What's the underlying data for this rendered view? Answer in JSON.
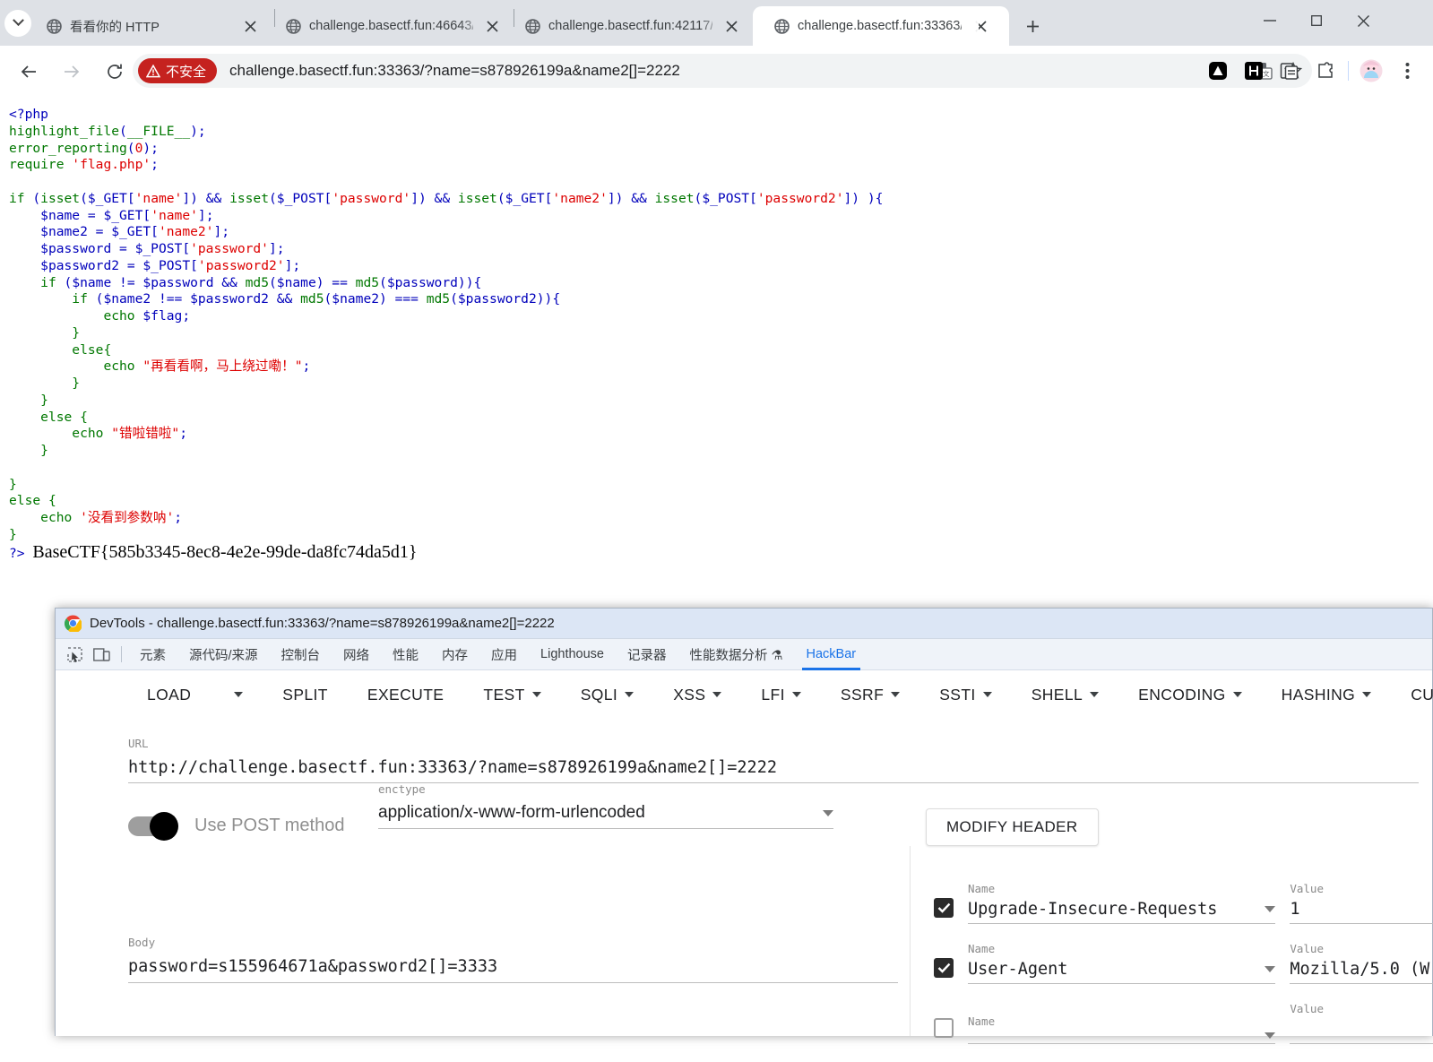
{
  "browser": {
    "tabs": [
      {
        "title": "看看你的 HTTP",
        "active": false
      },
      {
        "title": "challenge.basectf.fun:46643/",
        "active": false
      },
      {
        "title": "challenge.basectf.fun:42117/",
        "active": false
      },
      {
        "title": "challenge.basectf.fun:33363/",
        "active": true
      }
    ],
    "new_tab_label": "+",
    "nav": {
      "back": "←",
      "forward": "→",
      "reload": "⟳"
    },
    "omnibox": {
      "security_badge": "不安全",
      "url": "challenge.basectf.fun:33363/?name=s878926199a&name2[]=2222"
    },
    "window_controls": {
      "minimize": "—",
      "maximize": "▢",
      "close": "✕"
    }
  },
  "page": {
    "code_lines": [
      {
        "segments": [
          {
            "t": "<?php",
            "c": "kw"
          }
        ]
      },
      {
        "segments": [
          {
            "t": "highlight_file",
            "c": "def"
          },
          {
            "t": "(",
            "c": "kw"
          },
          {
            "t": "__FILE__",
            "c": "def"
          },
          {
            "t": ");",
            "c": "kw"
          }
        ]
      },
      {
        "segments": [
          {
            "t": "error_reporting",
            "c": "def"
          },
          {
            "t": "(",
            "c": "kw"
          },
          {
            "t": "0",
            "c": "str"
          },
          {
            "t": ");",
            "c": "kw"
          }
        ]
      },
      {
        "segments": [
          {
            "t": "require ",
            "c": "def"
          },
          {
            "t": "'flag.php'",
            "c": "str"
          },
          {
            "t": ";",
            "c": "kw"
          }
        ]
      },
      {
        "segments": []
      },
      {
        "segments": [
          {
            "t": "if ",
            "c": "def"
          },
          {
            "t": "(",
            "c": "kw"
          },
          {
            "t": "isset",
            "c": "def"
          },
          {
            "t": "(",
            "c": "kw"
          },
          {
            "t": "$_GET",
            "c": "dflt"
          },
          {
            "t": "[",
            "c": "kw"
          },
          {
            "t": "'name'",
            "c": "str"
          },
          {
            "t": "]) && ",
            "c": "kw"
          },
          {
            "t": "isset",
            "c": "def"
          },
          {
            "t": "(",
            "c": "kw"
          },
          {
            "t": "$_POST",
            "c": "dflt"
          },
          {
            "t": "[",
            "c": "kw"
          },
          {
            "t": "'password'",
            "c": "str"
          },
          {
            "t": "]) && ",
            "c": "kw"
          },
          {
            "t": "isset",
            "c": "def"
          },
          {
            "t": "(",
            "c": "kw"
          },
          {
            "t": "$_GET",
            "c": "dflt"
          },
          {
            "t": "[",
            "c": "kw"
          },
          {
            "t": "'name2'",
            "c": "str"
          },
          {
            "t": "]) && ",
            "c": "kw"
          },
          {
            "t": "isset",
            "c": "def"
          },
          {
            "t": "(",
            "c": "kw"
          },
          {
            "t": "$_POST",
            "c": "dflt"
          },
          {
            "t": "[",
            "c": "kw"
          },
          {
            "t": "'password2'",
            "c": "str"
          },
          {
            "t": "]) ){",
            "c": "kw"
          }
        ]
      },
      {
        "segments": [
          {
            "t": "    ",
            "c": "kw"
          },
          {
            "t": "$name",
            "c": "dflt"
          },
          {
            "t": " = ",
            "c": "kw"
          },
          {
            "t": "$_GET",
            "c": "dflt"
          },
          {
            "t": "[",
            "c": "kw"
          },
          {
            "t": "'name'",
            "c": "str"
          },
          {
            "t": "];",
            "c": "kw"
          }
        ]
      },
      {
        "segments": [
          {
            "t": "    ",
            "c": "kw"
          },
          {
            "t": "$name2",
            "c": "dflt"
          },
          {
            "t": " = ",
            "c": "kw"
          },
          {
            "t": "$_GET",
            "c": "dflt"
          },
          {
            "t": "[",
            "c": "kw"
          },
          {
            "t": "'name2'",
            "c": "str"
          },
          {
            "t": "];",
            "c": "kw"
          }
        ]
      },
      {
        "segments": [
          {
            "t": "    ",
            "c": "kw"
          },
          {
            "t": "$password",
            "c": "dflt"
          },
          {
            "t": " = ",
            "c": "kw"
          },
          {
            "t": "$_POST",
            "c": "dflt"
          },
          {
            "t": "[",
            "c": "kw"
          },
          {
            "t": "'password'",
            "c": "str"
          },
          {
            "t": "];",
            "c": "kw"
          }
        ]
      },
      {
        "segments": [
          {
            "t": "    ",
            "c": "kw"
          },
          {
            "t": "$password2",
            "c": "dflt"
          },
          {
            "t": " = ",
            "c": "kw"
          },
          {
            "t": "$_POST",
            "c": "dflt"
          },
          {
            "t": "[",
            "c": "kw"
          },
          {
            "t": "'password2'",
            "c": "str"
          },
          {
            "t": "];",
            "c": "kw"
          }
        ]
      },
      {
        "segments": [
          {
            "t": "    ",
            "c": "kw"
          },
          {
            "t": "if ",
            "c": "def"
          },
          {
            "t": "(",
            "c": "kw"
          },
          {
            "t": "$name",
            "c": "dflt"
          },
          {
            "t": " != ",
            "c": "kw"
          },
          {
            "t": "$password",
            "c": "dflt"
          },
          {
            "t": " && ",
            "c": "kw"
          },
          {
            "t": "md5",
            "c": "def"
          },
          {
            "t": "(",
            "c": "kw"
          },
          {
            "t": "$name",
            "c": "dflt"
          },
          {
            "t": ") == ",
            "c": "kw"
          },
          {
            "t": "md5",
            "c": "def"
          },
          {
            "t": "(",
            "c": "kw"
          },
          {
            "t": "$password",
            "c": "dflt"
          },
          {
            "t": ")){",
            "c": "kw"
          }
        ]
      },
      {
        "segments": [
          {
            "t": "        ",
            "c": "kw"
          },
          {
            "t": "if ",
            "c": "def"
          },
          {
            "t": "(",
            "c": "kw"
          },
          {
            "t": "$name2",
            "c": "dflt"
          },
          {
            "t": " !== ",
            "c": "kw"
          },
          {
            "t": "$password2",
            "c": "dflt"
          },
          {
            "t": " && ",
            "c": "kw"
          },
          {
            "t": "md5",
            "c": "def"
          },
          {
            "t": "(",
            "c": "kw"
          },
          {
            "t": "$name2",
            "c": "dflt"
          },
          {
            "t": ") === ",
            "c": "kw"
          },
          {
            "t": "md5",
            "c": "def"
          },
          {
            "t": "(",
            "c": "kw"
          },
          {
            "t": "$password2",
            "c": "dflt"
          },
          {
            "t": ")){",
            "c": "kw"
          }
        ]
      },
      {
        "segments": [
          {
            "t": "            ",
            "c": "kw"
          },
          {
            "t": "echo ",
            "c": "def"
          },
          {
            "t": "$flag",
            "c": "dflt"
          },
          {
            "t": ";",
            "c": "kw"
          }
        ]
      },
      {
        "segments": [
          {
            "t": "        }",
            "c": "def"
          }
        ]
      },
      {
        "segments": [
          {
            "t": "        ",
            "c": "kw"
          },
          {
            "t": "else",
            "c": "def"
          },
          {
            "t": "{",
            "c": "def"
          }
        ]
      },
      {
        "segments": [
          {
            "t": "            ",
            "c": "kw"
          },
          {
            "t": "echo ",
            "c": "def"
          },
          {
            "t": "\"再看看啊，马上绕过嘞！\"",
            "c": "str"
          },
          {
            "t": ";",
            "c": "kw"
          }
        ]
      },
      {
        "segments": [
          {
            "t": "        }",
            "c": "def"
          }
        ]
      },
      {
        "segments": [
          {
            "t": "    }",
            "c": "def"
          }
        ]
      },
      {
        "segments": [
          {
            "t": "    ",
            "c": "kw"
          },
          {
            "t": "else ",
            "c": "def"
          },
          {
            "t": "{",
            "c": "def"
          }
        ]
      },
      {
        "segments": [
          {
            "t": "        ",
            "c": "kw"
          },
          {
            "t": "echo ",
            "c": "def"
          },
          {
            "t": "\"错啦错啦\"",
            "c": "str"
          },
          {
            "t": ";",
            "c": "kw"
          }
        ]
      },
      {
        "segments": [
          {
            "t": "    }",
            "c": "def"
          }
        ]
      },
      {
        "segments": []
      },
      {
        "segments": [
          {
            "t": "}",
            "c": "def"
          }
        ]
      },
      {
        "segments": [
          {
            "t": "else ",
            "c": "def"
          },
          {
            "t": "{",
            "c": "def"
          }
        ]
      },
      {
        "segments": [
          {
            "t": "    ",
            "c": "kw"
          },
          {
            "t": "echo ",
            "c": "def"
          },
          {
            "t": "'没看到参数呐'",
            "c": "str"
          },
          {
            "t": ";",
            "c": "kw"
          }
        ]
      },
      {
        "segments": [
          {
            "t": "}",
            "c": "def"
          }
        ]
      }
    ],
    "close_tag": "?>",
    "flag": "BaseCTF{585b3345-8ec8-4e2e-99de-da8fc74da5d1}"
  },
  "devtools": {
    "window_title": "DevTools - challenge.basectf.fun:33363/?name=s878926199a&name2[]=2222",
    "panel_tabs": [
      {
        "label": "元素",
        "active": false
      },
      {
        "label": "源代码/来源",
        "active": false
      },
      {
        "label": "控制台",
        "active": false
      },
      {
        "label": "网络",
        "active": false
      },
      {
        "label": "性能",
        "active": false
      },
      {
        "label": "内存",
        "active": false
      },
      {
        "label": "应用",
        "active": false
      },
      {
        "label": "Lighthouse",
        "active": false
      },
      {
        "label": "记录器",
        "active": false
      },
      {
        "label": "性能数据分析 ⚗",
        "active": false
      },
      {
        "label": "HackBar",
        "active": true
      }
    ]
  },
  "hackbar": {
    "toolbar": [
      {
        "label": "LOAD",
        "dropdown": false,
        "sep_after": true
      },
      {
        "label": "",
        "dropdown": true,
        "only_caret": true
      },
      {
        "label": "SPLIT",
        "dropdown": false
      },
      {
        "label": "EXECUTE",
        "dropdown": false
      },
      {
        "label": "TEST",
        "dropdown": true
      },
      {
        "label": "SQLI",
        "dropdown": true
      },
      {
        "label": "XSS",
        "dropdown": true
      },
      {
        "label": "LFI",
        "dropdown": true
      },
      {
        "label": "SSRF",
        "dropdown": true
      },
      {
        "label": "SSTI",
        "dropdown": true
      },
      {
        "label": "SHELL",
        "dropdown": true
      },
      {
        "label": "ENCODING",
        "dropdown": true
      },
      {
        "label": "HASHING",
        "dropdown": true
      },
      {
        "label": "CUSTOM",
        "dropdown": true
      }
    ],
    "url_label": "URL",
    "url_value": "http://challenge.basectf.fun:33363/?name=s878926199a&name2[]=2222",
    "post_toggle_label": "Use POST method",
    "post_toggle_on": true,
    "enctype_label": "enctype",
    "enctype_value": "application/x-www-form-urlencoded",
    "body_label": "Body",
    "body_value": "password=s155964671a&password2[]=3333",
    "modify_header_label": "MODIFY HEADER",
    "header_name_label": "Name",
    "header_value_label": "Value",
    "headers": [
      {
        "checked": true,
        "name": "Upgrade-Insecure-Requests",
        "value": "1"
      },
      {
        "checked": true,
        "name": "User-Agent",
        "value": "Mozilla/5.0 (W"
      },
      {
        "checked": false,
        "name": "",
        "value": ""
      }
    ]
  }
}
